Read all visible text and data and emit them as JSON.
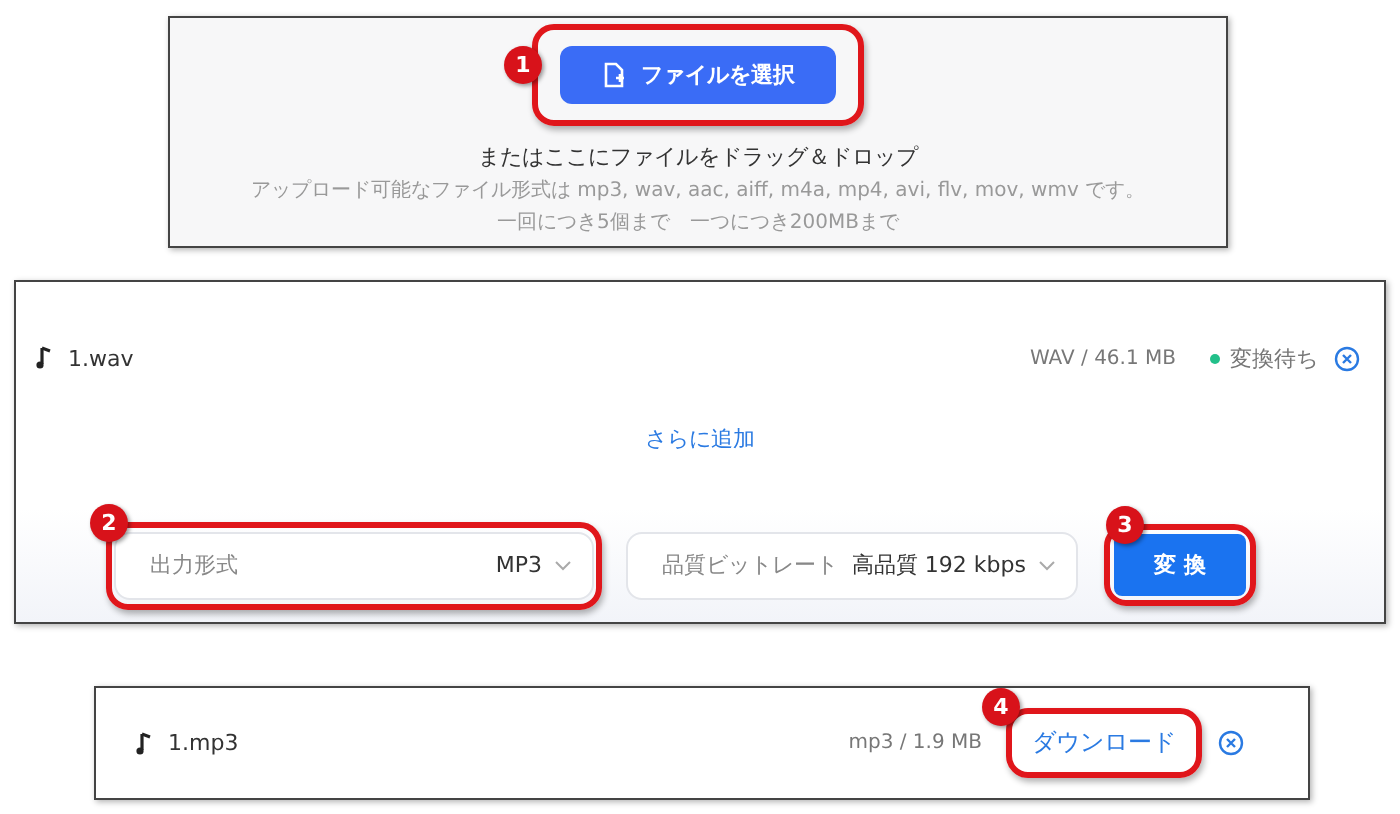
{
  "upload_panel": {
    "select_button": {
      "label": "ファイルを選択",
      "step": "1"
    },
    "drop_hint": "またはここにファイルをドラッグ＆ドロップ",
    "formats_note": "アップロード可能なファイル形式は mp3, wav, aac, aiff, m4a, mp4, avi, flv, mov, wmv です。",
    "limits_note": "一回につき5個まで　一つにつき200MBまで"
  },
  "queue_panel": {
    "files": [
      {
        "name": "1.wav",
        "info": "WAV / 46.1 MB",
        "status": "変換待ち",
        "color": "#22c08a"
      }
    ],
    "add_more": "さらに追加",
    "format_select": {
      "label": "出力形式",
      "value": "MP3",
      "step": "2"
    },
    "quality_select": {
      "label": "品質ビットレート",
      "value": "高品質 192 kbps"
    },
    "convert_button": {
      "label": "変 換",
      "step": "3"
    }
  },
  "result_panel": {
    "file": {
      "name": "1.mp3",
      "info": "mp3 / 1.9 MB",
      "download": {
        "label": "ダウンロード",
        "step": "4"
      }
    }
  }
}
